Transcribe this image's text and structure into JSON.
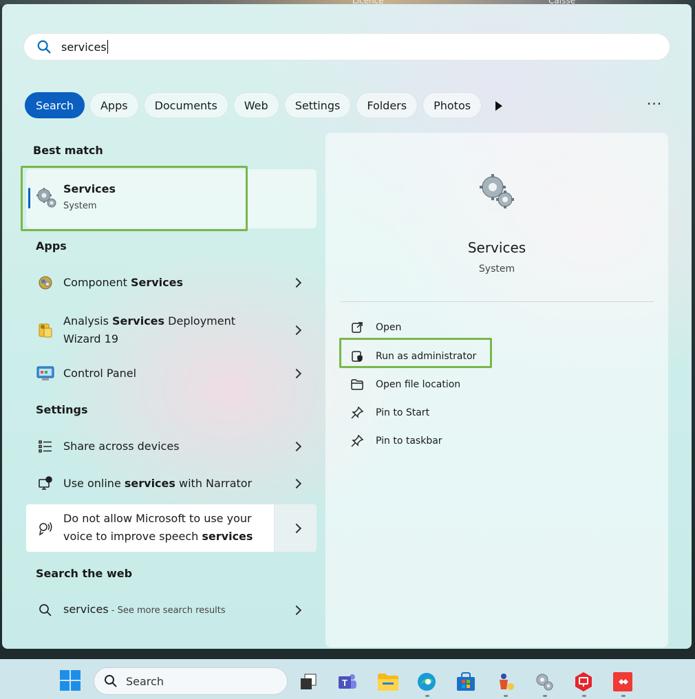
{
  "desktop": {
    "labels": [
      "Licence",
      "Caisse"
    ]
  },
  "search": {
    "query": "services"
  },
  "filters": [
    "Search",
    "Apps",
    "Documents",
    "Web",
    "Settings",
    "Folders",
    "Photos"
  ],
  "more_label": "···",
  "headings": {
    "best_match": "Best match",
    "apps": "Apps",
    "settings": "Settings",
    "web": "Search the web"
  },
  "best_match": {
    "name": "Services",
    "type": "System"
  },
  "apps": [
    {
      "pre": "Component ",
      "bold": "Services",
      "post": "",
      "line2": ""
    },
    {
      "pre": "Analysis ",
      "bold": "Services",
      "post": " Deployment",
      "line2": "Wizard 19"
    },
    {
      "pre": "Control Panel",
      "bold": "",
      "post": "",
      "line2": ""
    }
  ],
  "settings_items": [
    {
      "pre": "Share across devices",
      "bold": "",
      "post": ""
    },
    {
      "pre": "Use online ",
      "bold": "services",
      "post": " with Narrator"
    },
    {
      "pre": "Do not allow Microsoft to use your",
      "line2_pre": "voice to improve speech ",
      "bold": "services"
    }
  ],
  "web_result": {
    "query": "services",
    "sub": " - See more search results"
  },
  "detail": {
    "title": "Services",
    "subtitle": "System",
    "actions": [
      "Open",
      "Run as administrator",
      "Open file location",
      "Pin to Start",
      "Pin to taskbar"
    ]
  },
  "taskbar": {
    "search_label": "Search"
  }
}
